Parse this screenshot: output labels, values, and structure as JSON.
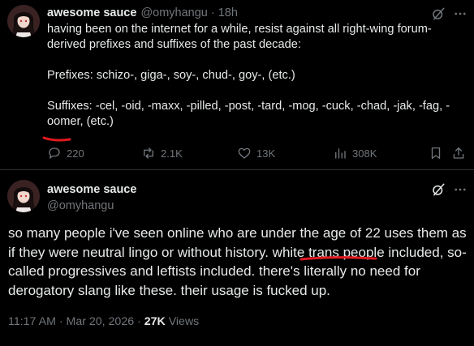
{
  "tweet1": {
    "author_name": "awesome sauce",
    "author_handle": "@omyhangu",
    "separator": "·",
    "time": "18h",
    "lines": [
      "having been on the internet for a while, resist against all right-wing forum-derived prefixes and suffixes of the past decade:",
      "Prefixes: schizo-, giga-, soy-, chud-, goy-, (etc.)",
      "Suffixes: -cel, -oid, -maxx, -pilled, -post, -tard, -mog, -cuck, -chad, -jak, -fag, -oomer, (etc.)"
    ],
    "stats": {
      "replies": "220",
      "reposts": "2.1K",
      "likes": "13K",
      "views": "308K"
    }
  },
  "tweet2": {
    "author_name": "awesome sauce",
    "author_handle": "@omyhangu",
    "body": "so many people i've seen online who are under the age of 22 uses them as if they were neutral lingo or without history. white trans people included, so-called progressives and leftists included. there's literally no need for derogatory slang like these. their usage is fucked up.",
    "timestamp": "11:17 AM · Mar 20, 2026 · ",
    "views_count": "27K",
    "views_label": " Views"
  },
  "icons": {
    "grok": "grok-icon",
    "more": "more-icon",
    "reply": "reply-icon",
    "repost": "repost-icon",
    "like": "heart-icon",
    "views": "views-icon",
    "bookmark": "bookmark-icon",
    "share": "share-icon"
  },
  "colors": {
    "background": "#000000",
    "text": "#e7e9ea",
    "muted": "#71767b",
    "annotation": "#e0191f"
  }
}
